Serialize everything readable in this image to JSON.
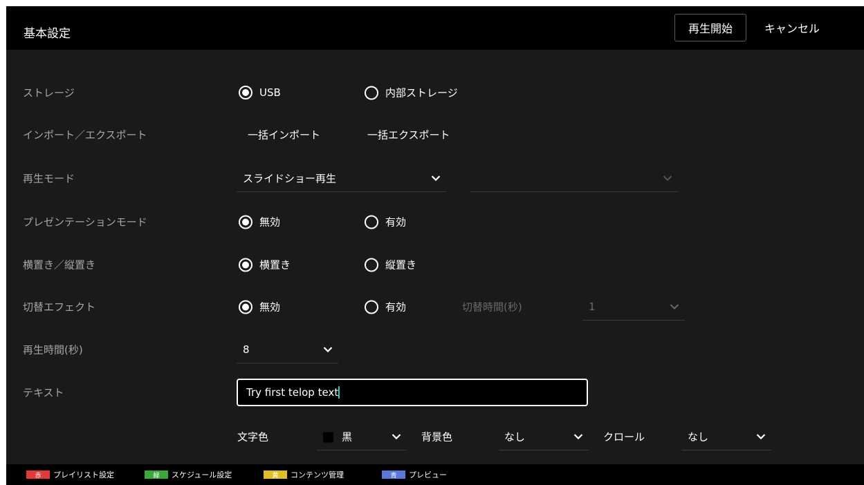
{
  "header": {
    "title": "基本設定",
    "start_label": "再生開始",
    "cancel_label": "キャンセル"
  },
  "rows": {
    "storage": {
      "label": "ストレージ",
      "opt1": "USB",
      "opt2": "内部ストレージ",
      "selected": "USB"
    },
    "import_export": {
      "label": "インポート／エクスポート",
      "import_label": "一括インポート",
      "export_label": "一括エクスポート"
    },
    "play_mode": {
      "label": "再生モード",
      "value": "スライドショー再生",
      "secondary_value": ""
    },
    "presentation_mode": {
      "label": "プレゼンテーションモード",
      "opt1": "無効",
      "opt2": "有効",
      "selected": "無効"
    },
    "orientation": {
      "label": "横置き／縦置き",
      "opt1": "横置き",
      "opt2": "縦置き",
      "selected": "横置き"
    },
    "transition_effect": {
      "label": "切替エフェクト",
      "opt1": "無効",
      "opt2": "有効",
      "selected": "無効",
      "time_label": "切替時間(秒)",
      "time_value": "1"
    },
    "play_time": {
      "label": "再生時間(秒)",
      "value": "8"
    },
    "text": {
      "label": "テキスト",
      "value": "Try first telop text"
    },
    "text_options": {
      "text_color_label": "文字色",
      "text_color_value": "黒",
      "bg_color_label": "背景色",
      "bg_color_value": "なし",
      "scroll_label": "クロール",
      "scroll_value": "なし"
    }
  },
  "footer": [
    {
      "badge": "赤",
      "label": "プレイリスト設定",
      "color": "#e03a3a"
    },
    {
      "badge": "緑",
      "label": "スケジュール設定",
      "color": "#3aa83a"
    },
    {
      "badge": "黄",
      "label": "コンテンツ管理",
      "color": "#e0c020"
    },
    {
      "badge": "青",
      "label": "プレビュー",
      "color": "#5a78d8"
    }
  ],
  "colors": {
    "background": "#1a1a1a",
    "header": "#000000",
    "label": "#a6a6a6",
    "caret": "#22c7b8"
  }
}
